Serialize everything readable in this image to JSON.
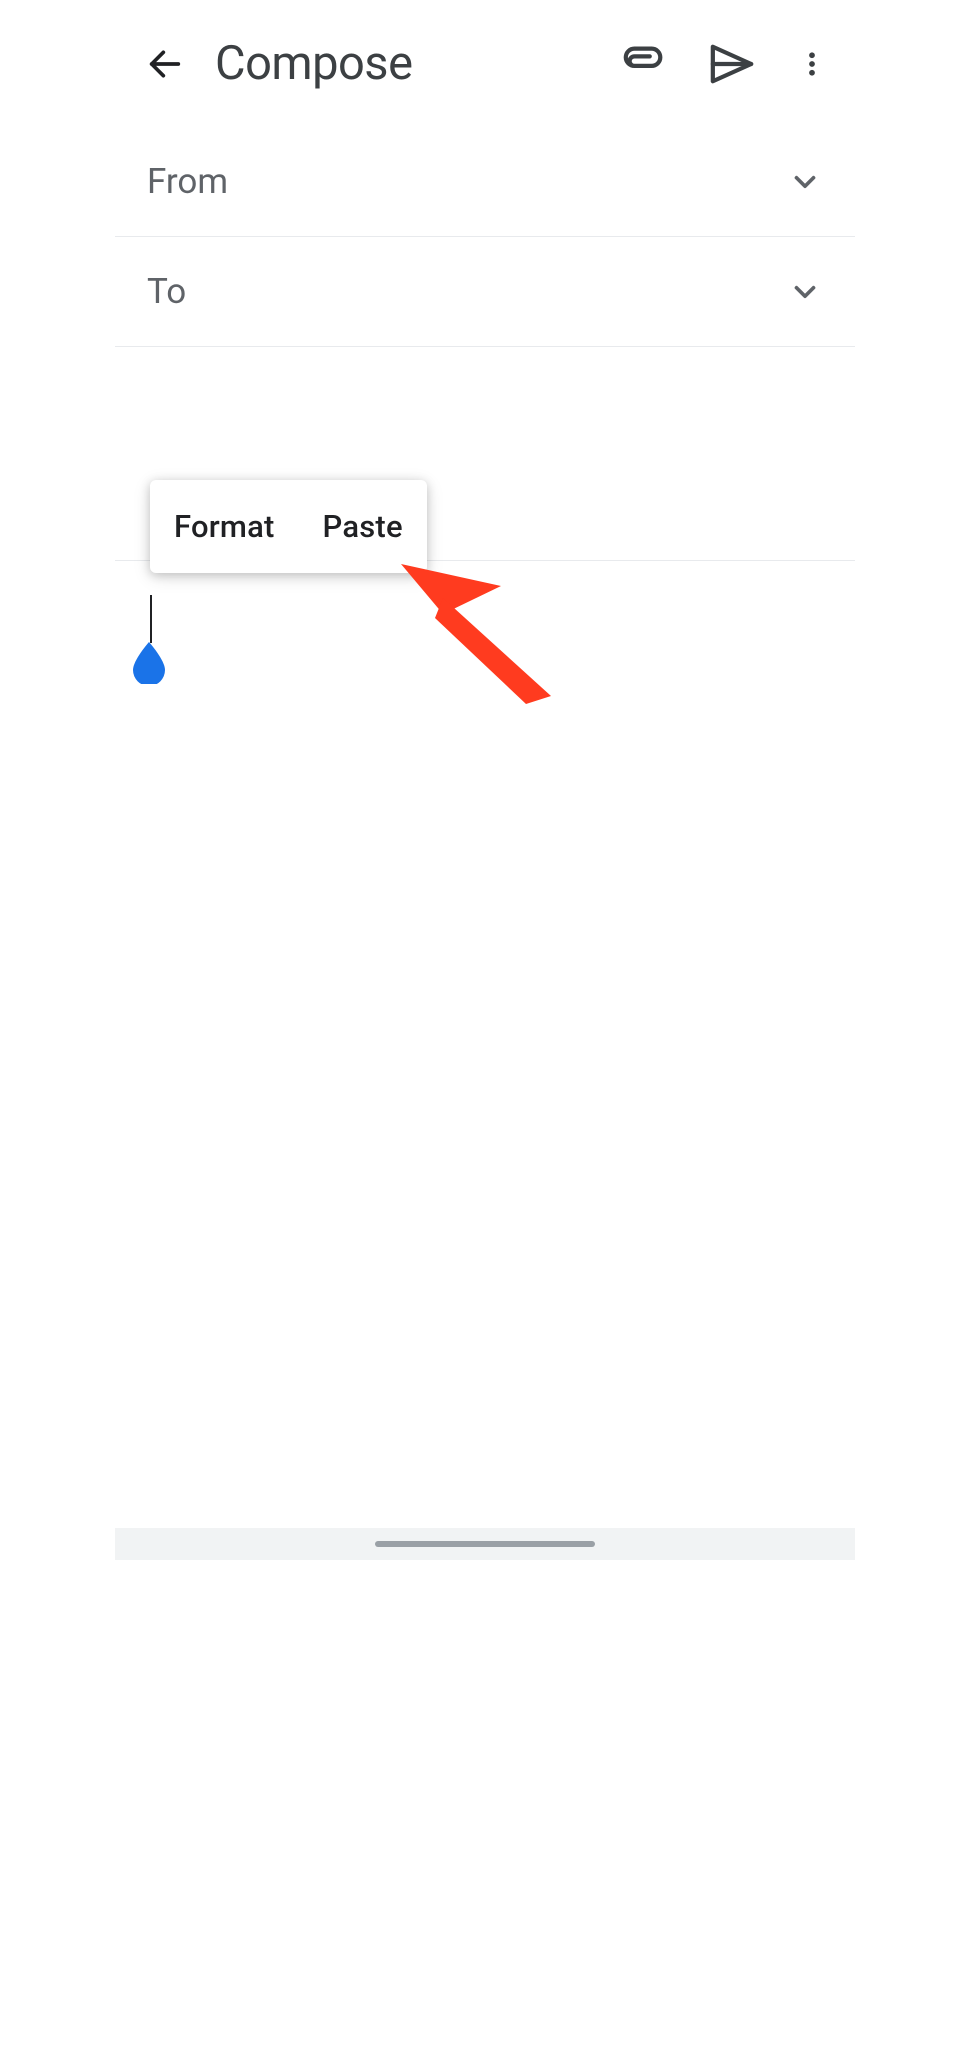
{
  "header": {
    "title": "Compose"
  },
  "fields": {
    "from_label": "From",
    "to_label": "To"
  },
  "context_menu": {
    "items": [
      "Format",
      "Paste"
    ]
  },
  "annotation": {
    "arrow_color": "#ff3b1f"
  },
  "cursor": {
    "handle_color": "#1a73e8"
  }
}
